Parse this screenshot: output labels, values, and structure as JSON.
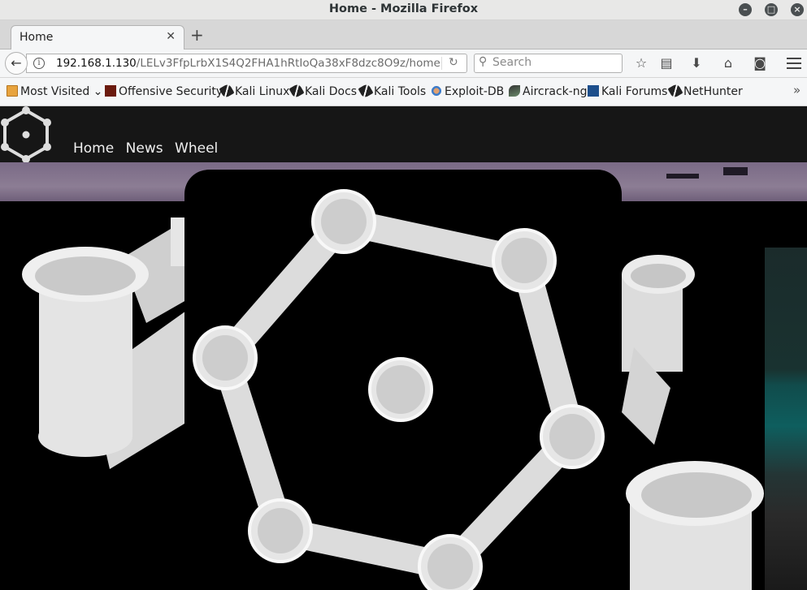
{
  "window": {
    "title": "Home - Mozilla Firefox"
  },
  "tabs": [
    {
      "label": "Home"
    }
  ],
  "nav": {
    "url_host": "192.168.1.130",
    "url_path": "/LELv3FfpLrbX1S4Q2FHA1hRtIoQa38xF8dzc8O9z/home",
    "search_placeholder": "Search"
  },
  "bookmarks": [
    {
      "label": "Most Visited",
      "icon": "folder-icon"
    },
    {
      "label": "Offensive Security",
      "icon": "offsec-icon"
    },
    {
      "label": "Kali Linux",
      "icon": "kali-dragon-icon"
    },
    {
      "label": "Kali Docs",
      "icon": "kali-dragon-icon"
    },
    {
      "label": "Kali Tools",
      "icon": "kali-dragon-icon"
    },
    {
      "label": "Exploit-DB",
      "icon": "exploitdb-icon"
    },
    {
      "label": "Aircrack-ng",
      "icon": "aircrack-icon"
    },
    {
      "label": "Kali Forums",
      "icon": "kali-forums-icon"
    },
    {
      "label": "NetHunter",
      "icon": "kali-dragon-icon"
    }
  ],
  "site": {
    "nav": [
      {
        "label": "Home"
      },
      {
        "label": "News"
      },
      {
        "label": "Wheel"
      }
    ]
  },
  "colors": {
    "header_bg": "#161616",
    "glitch_purple": "#8c7d94",
    "glitch_teal": "#0e5e5e"
  }
}
